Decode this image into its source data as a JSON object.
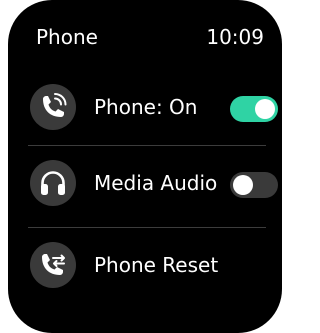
{
  "header": {
    "title": "Phone",
    "time": "10:09"
  },
  "items": [
    {
      "label": "Phone: On",
      "icon": "phone-ringing-icon",
      "toggle": "on"
    },
    {
      "label": "Media Audio",
      "icon": "headphones-icon",
      "toggle": "off"
    },
    {
      "label": "Phone Reset",
      "icon": "phone-reset-icon"
    }
  ],
  "colors": {
    "accent": "#2fd3a4",
    "background": "#000000",
    "icon_bg": "#3a3a3a",
    "divider": "#3c3c3c"
  }
}
